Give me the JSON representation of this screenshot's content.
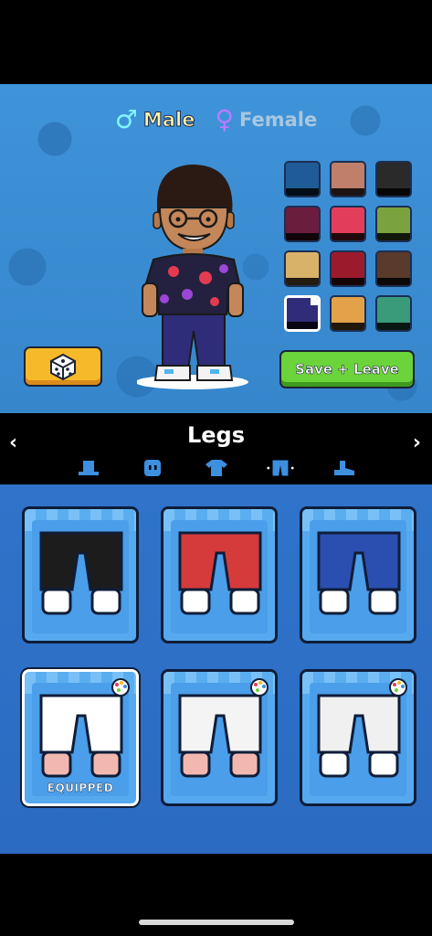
{
  "gender": {
    "male_symbol": "♂",
    "male_label": "Male",
    "female_symbol": "♀",
    "female_label": "Female",
    "selected": "Male"
  },
  "swatches": [
    {
      "color": "#1f5c97",
      "selected": false
    },
    {
      "color": "#c07f6b",
      "selected": false
    },
    {
      "color": "#2a2a2a",
      "selected": false
    },
    {
      "color": "#6b1d3d",
      "selected": false
    },
    {
      "color": "#e23e5a",
      "selected": false
    },
    {
      "color": "#7aa23f",
      "selected": false
    },
    {
      "color": "#d9b26a",
      "selected": false
    },
    {
      "color": "#9b1b2c",
      "selected": false
    },
    {
      "color": "#5a3a2a",
      "selected": false
    },
    {
      "color": "#2f2c7a",
      "selected": true
    },
    {
      "color": "#e3a24a",
      "selected": false
    },
    {
      "color": "#3a9b7a",
      "selected": false
    }
  ],
  "buttons": {
    "save_label": "Save + Leave",
    "random_icon": "dice-icon"
  },
  "category": {
    "title": "Legs",
    "left_arrow": "‹",
    "right_arrow": "›",
    "tabs": [
      "hat-icon",
      "face-icon",
      "shirt-icon",
      "pants-icon",
      "shoes-icon"
    ],
    "active_tab": "pants-icon"
  },
  "items": [
    {
      "pants": "#1c1c1c",
      "cuff": "#ffffff",
      "palette": false,
      "equipped": false
    },
    {
      "pants": "#d63b3b",
      "cuff": "#ffffff",
      "palette": false,
      "equipped": false
    },
    {
      "pants": "#2b4fb0",
      "cuff": "#ffffff",
      "palette": false,
      "equipped": false
    },
    {
      "pants": "#ffffff",
      "cuff": "#f2b8b0",
      "palette": true,
      "equipped": true
    },
    {
      "pants": "#f4f4f4",
      "cuff": "#f2b8b0",
      "palette": true,
      "equipped": false
    },
    {
      "pants": "#f0f0f0",
      "cuff": "#ffffff",
      "palette": true,
      "equipped": false
    }
  ],
  "equipped_label": "EQUIPPED",
  "colors": {
    "accent_blue": "#3b8fd4",
    "save_green": "#6bd43a",
    "random_yellow": "#f5b929"
  }
}
